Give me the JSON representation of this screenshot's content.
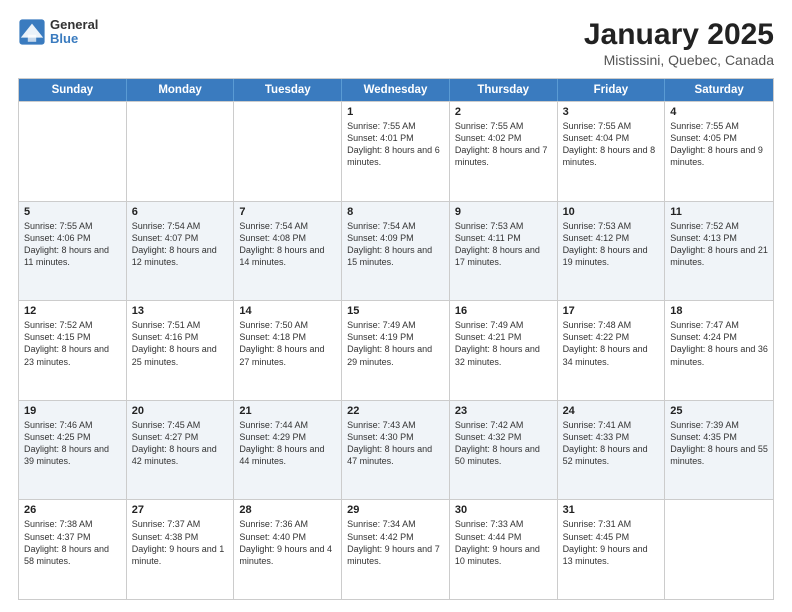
{
  "logo": {
    "general": "General",
    "blue": "Blue"
  },
  "header": {
    "title": "January 2025",
    "subtitle": "Mistissini, Quebec, Canada"
  },
  "weekdays": [
    "Sunday",
    "Monday",
    "Tuesday",
    "Wednesday",
    "Thursday",
    "Friday",
    "Saturday"
  ],
  "weeks": [
    {
      "alt": false,
      "days": [
        {
          "day": "",
          "sunrise": "",
          "sunset": "",
          "daylight": ""
        },
        {
          "day": "",
          "sunrise": "",
          "sunset": "",
          "daylight": ""
        },
        {
          "day": "",
          "sunrise": "",
          "sunset": "",
          "daylight": ""
        },
        {
          "day": "1",
          "sunrise": "Sunrise: 7:55 AM",
          "sunset": "Sunset: 4:01 PM",
          "daylight": "Daylight: 8 hours and 6 minutes."
        },
        {
          "day": "2",
          "sunrise": "Sunrise: 7:55 AM",
          "sunset": "Sunset: 4:02 PM",
          "daylight": "Daylight: 8 hours and 7 minutes."
        },
        {
          "day": "3",
          "sunrise": "Sunrise: 7:55 AM",
          "sunset": "Sunset: 4:04 PM",
          "daylight": "Daylight: 8 hours and 8 minutes."
        },
        {
          "day": "4",
          "sunrise": "Sunrise: 7:55 AM",
          "sunset": "Sunset: 4:05 PM",
          "daylight": "Daylight: 8 hours and 9 minutes."
        }
      ]
    },
    {
      "alt": true,
      "days": [
        {
          "day": "5",
          "sunrise": "Sunrise: 7:55 AM",
          "sunset": "Sunset: 4:06 PM",
          "daylight": "Daylight: 8 hours and 11 minutes."
        },
        {
          "day": "6",
          "sunrise": "Sunrise: 7:54 AM",
          "sunset": "Sunset: 4:07 PM",
          "daylight": "Daylight: 8 hours and 12 minutes."
        },
        {
          "day": "7",
          "sunrise": "Sunrise: 7:54 AM",
          "sunset": "Sunset: 4:08 PM",
          "daylight": "Daylight: 8 hours and 14 minutes."
        },
        {
          "day": "8",
          "sunrise": "Sunrise: 7:54 AM",
          "sunset": "Sunset: 4:09 PM",
          "daylight": "Daylight: 8 hours and 15 minutes."
        },
        {
          "day": "9",
          "sunrise": "Sunrise: 7:53 AM",
          "sunset": "Sunset: 4:11 PM",
          "daylight": "Daylight: 8 hours and 17 minutes."
        },
        {
          "day": "10",
          "sunrise": "Sunrise: 7:53 AM",
          "sunset": "Sunset: 4:12 PM",
          "daylight": "Daylight: 8 hours and 19 minutes."
        },
        {
          "day": "11",
          "sunrise": "Sunrise: 7:52 AM",
          "sunset": "Sunset: 4:13 PM",
          "daylight": "Daylight: 8 hours and 21 minutes."
        }
      ]
    },
    {
      "alt": false,
      "days": [
        {
          "day": "12",
          "sunrise": "Sunrise: 7:52 AM",
          "sunset": "Sunset: 4:15 PM",
          "daylight": "Daylight: 8 hours and 23 minutes."
        },
        {
          "day": "13",
          "sunrise": "Sunrise: 7:51 AM",
          "sunset": "Sunset: 4:16 PM",
          "daylight": "Daylight: 8 hours and 25 minutes."
        },
        {
          "day": "14",
          "sunrise": "Sunrise: 7:50 AM",
          "sunset": "Sunset: 4:18 PM",
          "daylight": "Daylight: 8 hours and 27 minutes."
        },
        {
          "day": "15",
          "sunrise": "Sunrise: 7:49 AM",
          "sunset": "Sunset: 4:19 PM",
          "daylight": "Daylight: 8 hours and 29 minutes."
        },
        {
          "day": "16",
          "sunrise": "Sunrise: 7:49 AM",
          "sunset": "Sunset: 4:21 PM",
          "daylight": "Daylight: 8 hours and 32 minutes."
        },
        {
          "day": "17",
          "sunrise": "Sunrise: 7:48 AM",
          "sunset": "Sunset: 4:22 PM",
          "daylight": "Daylight: 8 hours and 34 minutes."
        },
        {
          "day": "18",
          "sunrise": "Sunrise: 7:47 AM",
          "sunset": "Sunset: 4:24 PM",
          "daylight": "Daylight: 8 hours and 36 minutes."
        }
      ]
    },
    {
      "alt": true,
      "days": [
        {
          "day": "19",
          "sunrise": "Sunrise: 7:46 AM",
          "sunset": "Sunset: 4:25 PM",
          "daylight": "Daylight: 8 hours and 39 minutes."
        },
        {
          "day": "20",
          "sunrise": "Sunrise: 7:45 AM",
          "sunset": "Sunset: 4:27 PM",
          "daylight": "Daylight: 8 hours and 42 minutes."
        },
        {
          "day": "21",
          "sunrise": "Sunrise: 7:44 AM",
          "sunset": "Sunset: 4:29 PM",
          "daylight": "Daylight: 8 hours and 44 minutes."
        },
        {
          "day": "22",
          "sunrise": "Sunrise: 7:43 AM",
          "sunset": "Sunset: 4:30 PM",
          "daylight": "Daylight: 8 hours and 47 minutes."
        },
        {
          "day": "23",
          "sunrise": "Sunrise: 7:42 AM",
          "sunset": "Sunset: 4:32 PM",
          "daylight": "Daylight: 8 hours and 50 minutes."
        },
        {
          "day": "24",
          "sunrise": "Sunrise: 7:41 AM",
          "sunset": "Sunset: 4:33 PM",
          "daylight": "Daylight: 8 hours and 52 minutes."
        },
        {
          "day": "25",
          "sunrise": "Sunrise: 7:39 AM",
          "sunset": "Sunset: 4:35 PM",
          "daylight": "Daylight: 8 hours and 55 minutes."
        }
      ]
    },
    {
      "alt": false,
      "days": [
        {
          "day": "26",
          "sunrise": "Sunrise: 7:38 AM",
          "sunset": "Sunset: 4:37 PM",
          "daylight": "Daylight: 8 hours and 58 minutes."
        },
        {
          "day": "27",
          "sunrise": "Sunrise: 7:37 AM",
          "sunset": "Sunset: 4:38 PM",
          "daylight": "Daylight: 9 hours and 1 minute."
        },
        {
          "day": "28",
          "sunrise": "Sunrise: 7:36 AM",
          "sunset": "Sunset: 4:40 PM",
          "daylight": "Daylight: 9 hours and 4 minutes."
        },
        {
          "day": "29",
          "sunrise": "Sunrise: 7:34 AM",
          "sunset": "Sunset: 4:42 PM",
          "daylight": "Daylight: 9 hours and 7 minutes."
        },
        {
          "day": "30",
          "sunrise": "Sunrise: 7:33 AM",
          "sunset": "Sunset: 4:44 PM",
          "daylight": "Daylight: 9 hours and 10 minutes."
        },
        {
          "day": "31",
          "sunrise": "Sunrise: 7:31 AM",
          "sunset": "Sunset: 4:45 PM",
          "daylight": "Daylight: 9 hours and 13 minutes."
        },
        {
          "day": "",
          "sunrise": "",
          "sunset": "",
          "daylight": ""
        }
      ]
    }
  ]
}
